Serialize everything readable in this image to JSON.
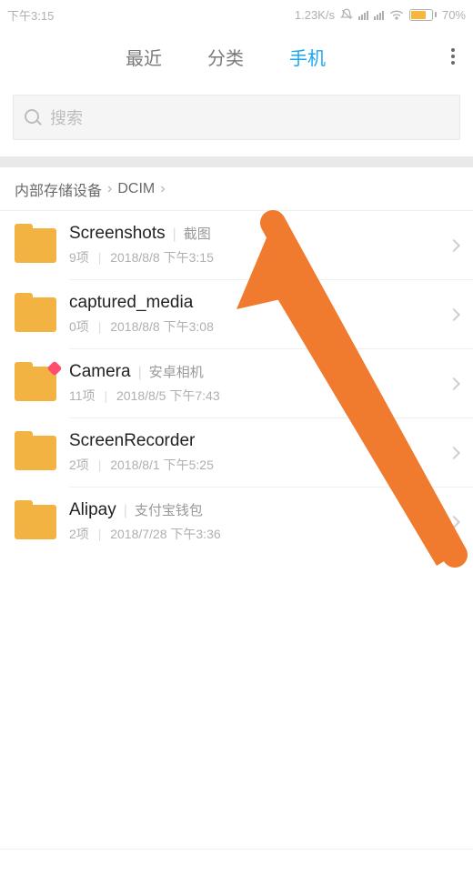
{
  "status": {
    "time": "下午3:15",
    "speed": "1.23K/s",
    "battery_pct": "70%"
  },
  "tabs": {
    "recent": "最近",
    "category": "分类",
    "phone": "手机"
  },
  "search": {
    "placeholder": "搜索"
  },
  "breadcrumb": {
    "root": "内部存储设备",
    "dcim": "DCIM"
  },
  "folders": [
    {
      "name": "Screenshots",
      "alias": "截图",
      "count": "9项",
      "date": "2018/8/8 下午3:15",
      "badge": false
    },
    {
      "name": "captured_media",
      "alias": "",
      "count": "0项",
      "date": "2018/8/8 下午3:08",
      "badge": false
    },
    {
      "name": "Camera",
      "alias": "安卓相机",
      "count": "11项",
      "date": "2018/8/5 下午7:43",
      "badge": true
    },
    {
      "name": "ScreenRecorder",
      "alias": "",
      "count": "2项",
      "date": "2018/8/1 下午5:25",
      "badge": false
    },
    {
      "name": "Alipay",
      "alias": "支付宝钱包",
      "count": "2项",
      "date": "2018/7/28 下午3:36",
      "badge": false
    }
  ],
  "annotation": {
    "arrow_color": "#f07a2e"
  }
}
